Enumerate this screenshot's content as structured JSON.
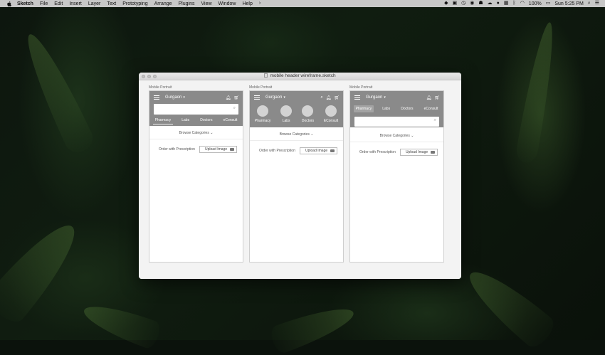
{
  "menubar": {
    "app_name": "Sketch",
    "items": [
      "File",
      "Edit",
      "Insert",
      "Layer",
      "Text",
      "Prototyping",
      "Arrange",
      "Plugins",
      "View",
      "Window",
      "Help"
    ],
    "battery": "100%",
    "clock": "Sun 5:25 PM"
  },
  "window": {
    "title": "mobile header wireframe.sketch"
  },
  "artboards": [
    {
      "label": "Mobile Portrait",
      "location": "Gurgaon",
      "tabs": [
        "Pharmacy",
        "Labs",
        "Doctors",
        "eConsult"
      ],
      "browse": "Browse Categories",
      "order_text": "Order with Prescription",
      "upload_label": "Upload Image"
    },
    {
      "label": "Mobile Portrait",
      "location": "Gurgaon",
      "tabs": [
        "Pharmacy",
        "Labs",
        "Doctors",
        "EConsult"
      ],
      "browse": "Browse Categories",
      "order_text": "Order with Prescription",
      "upload_label": "Upload Image"
    },
    {
      "label": "Mobile Portrait",
      "location": "Gurgaon",
      "tabs": [
        "Pharmacy",
        "Labs",
        "Doctors",
        "eConsult"
      ],
      "browse": "Browse Categories",
      "order_text": "Order with Prescription",
      "upload_label": "Upload Image"
    }
  ],
  "icons": {
    "menu": "hamburger-icon",
    "bell": "bell-icon",
    "cart": "cart-icon",
    "search": "search-icon",
    "camera": "camera-icon"
  }
}
